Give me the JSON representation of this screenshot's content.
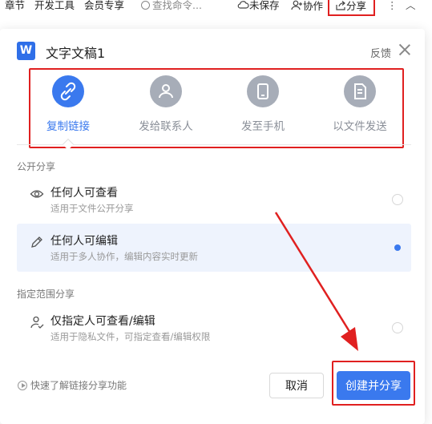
{
  "toolbar": {
    "items": [
      "章节",
      "开发工具",
      "会员专享"
    ],
    "search_placeholder": "查找命令...",
    "unsaved": "未保存",
    "collab": "协作",
    "share": "分享",
    "more": "⋮",
    "collapse": "︿"
  },
  "dialog": {
    "icon_letter": "W",
    "title": "文字文稿1",
    "feedback": "反馈"
  },
  "tabs": [
    {
      "label": "复制链接",
      "icon": "link-icon",
      "active": true
    },
    {
      "label": "发给联系人",
      "icon": "contact-icon",
      "active": false
    },
    {
      "label": "发至手机",
      "icon": "phone-icon",
      "active": false
    },
    {
      "label": "以文件发送",
      "icon": "file-icon",
      "active": false
    }
  ],
  "public_section": {
    "label": "公开分享",
    "options": [
      {
        "title": "任何人可查看",
        "subtitle": "适用于文件公开分享",
        "icon": "eye-icon",
        "selected": false
      },
      {
        "title": "任何人可编辑",
        "subtitle": "适用于多人协作，编辑内容实时更新",
        "icon": "pencil-icon",
        "selected": true
      }
    ]
  },
  "scoped_section": {
    "label": "指定范围分享",
    "options": [
      {
        "title": "仅指定人可查看/编辑",
        "subtitle": "适用于隐私文件，可指定查看/编辑权限",
        "icon": "user-check-icon",
        "selected": false
      }
    ]
  },
  "footer": {
    "quick_learn": "快速了解链接分享功能",
    "cancel": "取消",
    "create": "创建并分享"
  },
  "colors": {
    "accent": "#3a79ee",
    "highlight_red": "#e02020",
    "selected_bg": "#eef3fd"
  }
}
